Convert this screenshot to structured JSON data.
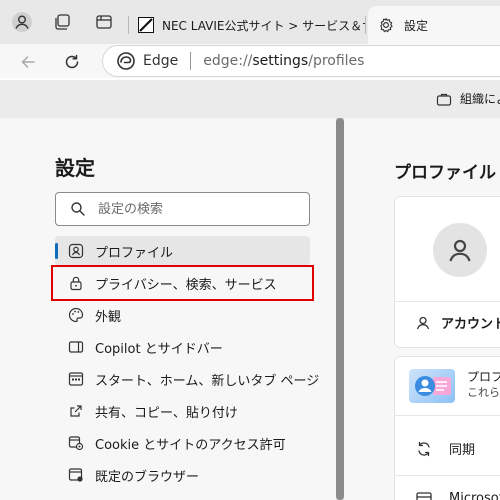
{
  "tabs": [
    {
      "title": "NEC LAVIE公式サイト > サービス＆サ",
      "active": false
    },
    {
      "title": "設定",
      "active": true
    }
  ],
  "address_bar": {
    "brand": "Edge",
    "url_prefix": "edge://",
    "url_host": "settings",
    "url_path": "/profiles"
  },
  "infobar": {
    "text": "組織によ"
  },
  "sidebar": {
    "title": "設定",
    "search_placeholder": "設定の検索",
    "items": [
      {
        "label": "プロファイル",
        "icon": "profile-icon",
        "selected": true
      },
      {
        "label": "プライバシー、検索、サービス",
        "icon": "lock-icon",
        "highlighted": true
      },
      {
        "label": "外観",
        "icon": "palette-icon"
      },
      {
        "label": "Copilot とサイドバー",
        "icon": "sidebar-icon"
      },
      {
        "label": "スタート、ホーム、新しいタブ ページ",
        "icon": "start-page-icon"
      },
      {
        "label": "共有、コピー、貼り付け",
        "icon": "share-icon"
      },
      {
        "label": "Cookie とサイトのアクセス許可",
        "icon": "cookie-icon"
      },
      {
        "label": "既定のブラウザー",
        "icon": "default-browser-icon"
      }
    ]
  },
  "main": {
    "title": "プロファイル",
    "account_label": "アカウント",
    "promo_title": "プロフ",
    "promo_sub": "これら",
    "sync_label": "同期",
    "ms_label": "Microsof"
  },
  "colors": {
    "accent": "#0f6cbd",
    "highlight": "#e00000"
  }
}
